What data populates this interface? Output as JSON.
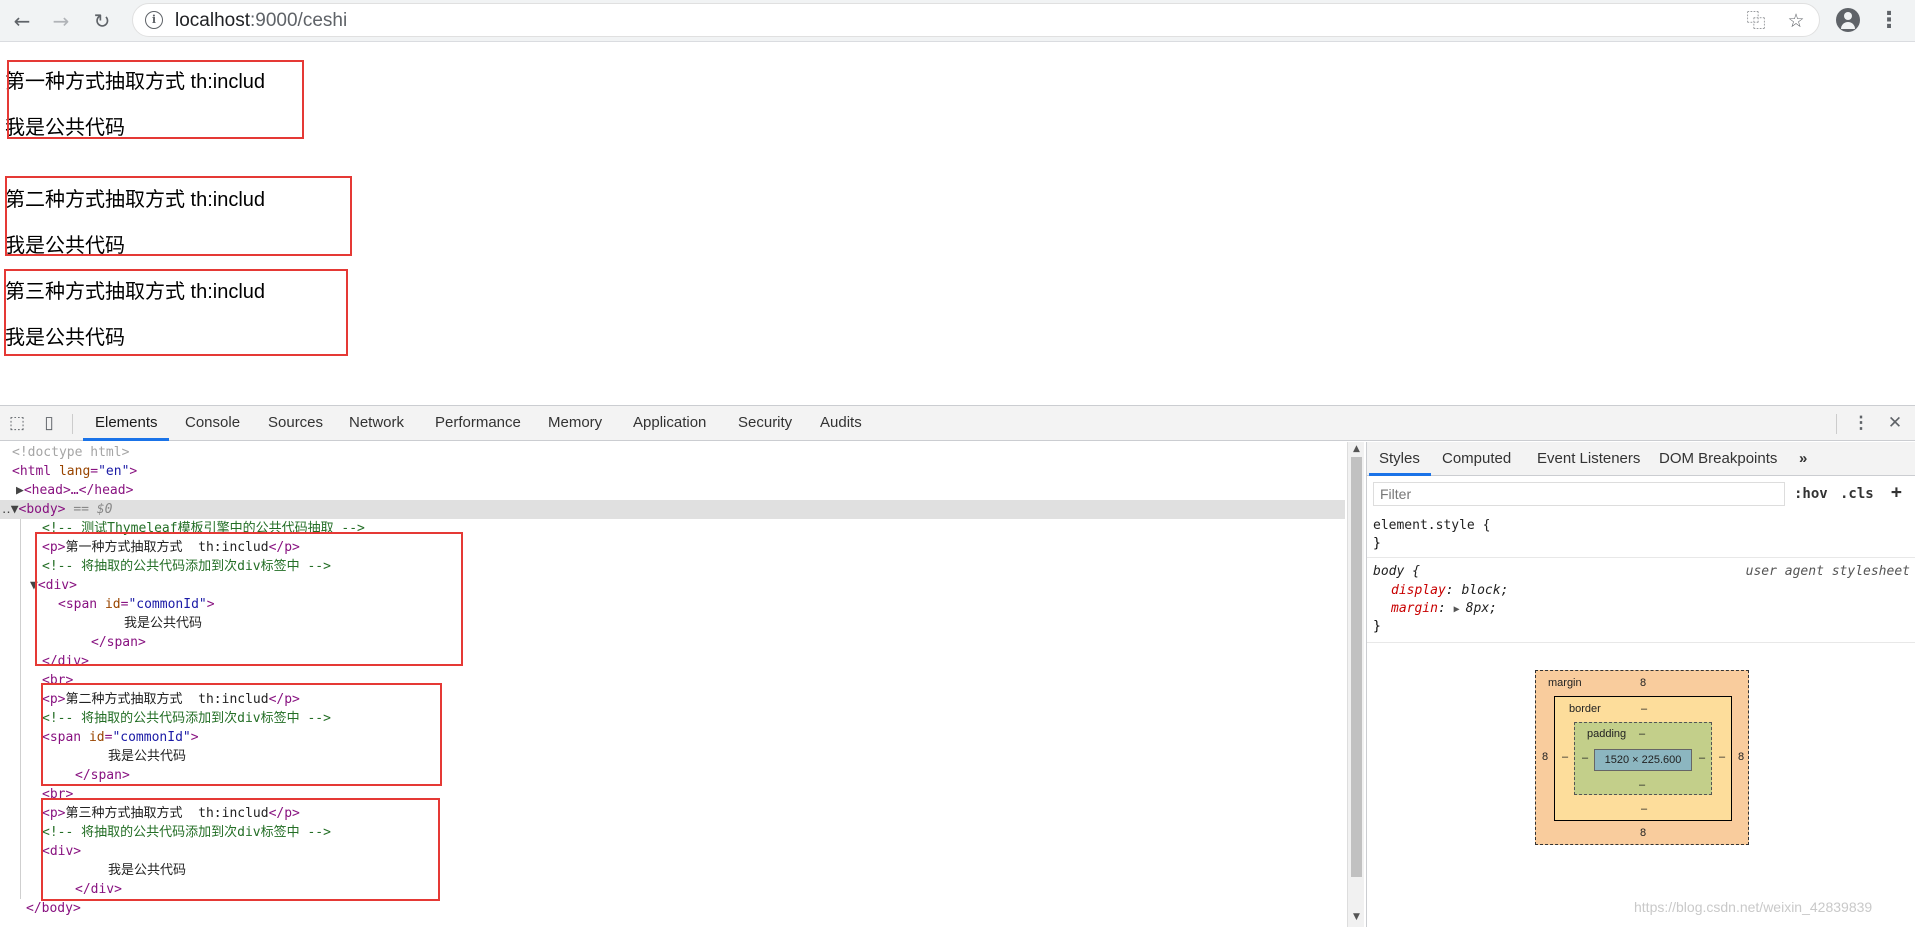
{
  "browser": {
    "url_host": "localhost",
    "url_rest": ":9000/ceshi",
    "icons": [
      "back-arrow-icon",
      "forward-arrow-icon",
      "reload-icon",
      "info-icon",
      "translate-icon",
      "star-icon",
      "account-icon",
      "menu-icon"
    ]
  },
  "page": {
    "sections": [
      {
        "heading": "第一种方式抽取方式 th:includ",
        "body": "我是公共代码"
      },
      {
        "heading": "第二种方式抽取方式 th:includ",
        "body": "我是公共代码"
      },
      {
        "heading": "第三种方式抽取方式 th:includ",
        "body": "我是公共代码"
      }
    ]
  },
  "devtools": {
    "tabs": [
      "Elements",
      "Console",
      "Sources",
      "Network",
      "Performance",
      "Memory",
      "Application",
      "Security",
      "Audits"
    ],
    "active_tab": "Elements",
    "code": {
      "doctype": "<!doctype html>",
      "html_open": "<html",
      "lang_attr": "lang",
      "lang_val": "\"en\"",
      "head": "<head>…</head>",
      "body_open": "<body>",
      "body_marker": "== $0",
      "comment1": "<!-- 测试Thymeleaf模板引擎中的公共代码抽取 -->",
      "p1_open": "<p>",
      "p1_text": "第一种方式抽取方式  th:includ",
      "p_close": "</p>",
      "comment_add": "<!-- 将抽取的公共代码添加到次div标签中 -->",
      "div_open": "<div>",
      "span_open": "<span",
      "id_attr": "id",
      "id_val": "\"commonId\"",
      "gt": ">",
      "common_text": "我是公共代码",
      "span_close": "</span>",
      "div_close": "</div>",
      "br": "<br>",
      "p2_text": "第二种方式抽取方式  th:includ",
      "p3_text": "第三种方式抽取方式  th:includ",
      "body_close": "</body>"
    },
    "styles": {
      "tabs": [
        "Styles",
        "Computed",
        "Event Listeners",
        "DOM Breakpoints"
      ],
      "active_tab": "Styles",
      "more": "»",
      "filter_placeholder": "Filter",
      "hov": ":hov",
      "cls": ".cls",
      "plus": "+",
      "element_style": "element.style {",
      "close_brace": "}",
      "body_selector": "body {",
      "user_agent": "user agent stylesheet",
      "display_prop": "display",
      "display_val": "block;",
      "margin_prop": "margin",
      "margin_val": "8px;",
      "box": {
        "margin_label": "margin",
        "border_label": "border",
        "padding_label": "padding",
        "margin_top": "8",
        "margin_right": "8",
        "margin_bottom": "8",
        "margin_left": "8",
        "border_top": "–",
        "border_right": "–",
        "border_bottom": "–",
        "border_left": "–",
        "padding_top": "–",
        "padding_right": "–",
        "padding_bottom": "–",
        "padding_left": "–",
        "content": "1520 × 225.600"
      }
    },
    "watermark": "https://blog.csdn.net/weixin_42839839"
  },
  "colors": {
    "highlight": "#e53935",
    "accent": "#1a73e8"
  }
}
